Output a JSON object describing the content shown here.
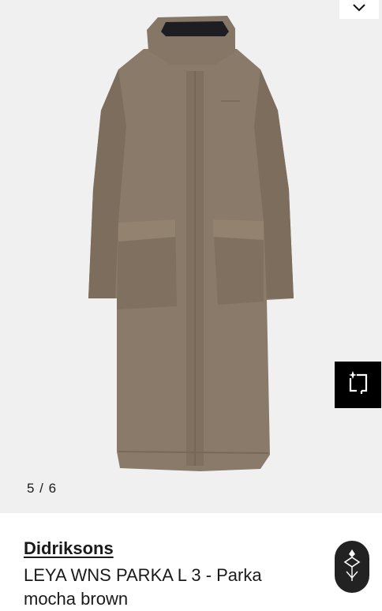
{
  "gallery": {
    "counter": "5 / 6",
    "icons": {
      "collapse": "chevron-down-icon",
      "try_on": "sparkle-frame-icon"
    }
  },
  "product": {
    "brand": "Didriksons",
    "title": "LEYA WNS PARKA L 3 - Parka",
    "color": "mocha brown"
  },
  "colors": {
    "coat": "#8a7a6a",
    "background": "#f0f0f0"
  }
}
